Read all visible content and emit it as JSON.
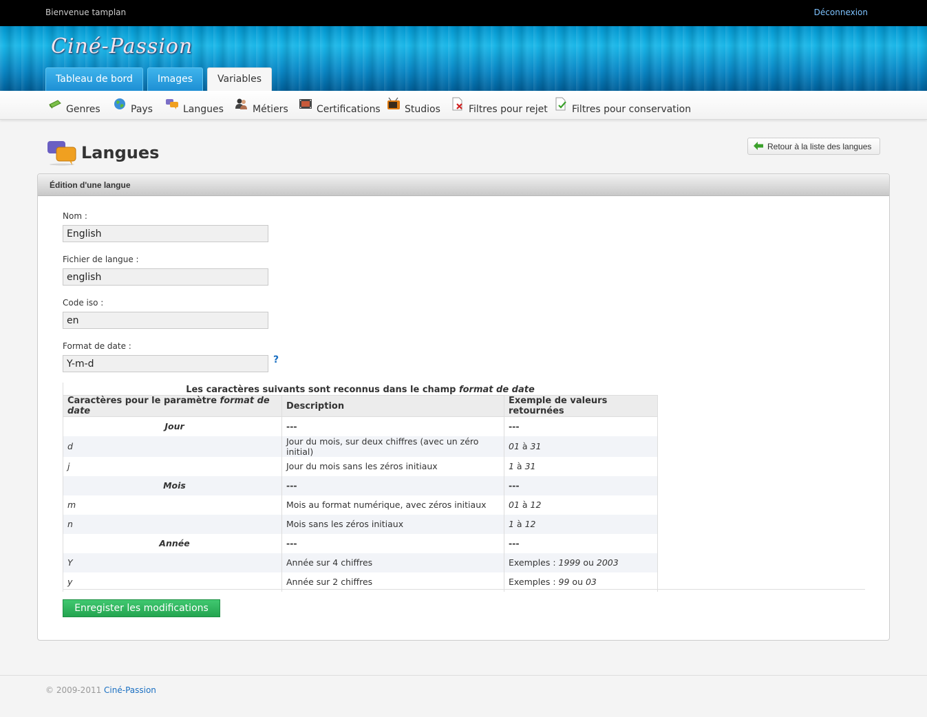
{
  "topbar": {
    "welcome": "Bienvenue tamplan",
    "logout": "Déconnexion"
  },
  "header": {
    "logo": "Ciné-Passion",
    "tabs": [
      {
        "label": "Tableau de bord",
        "active": false
      },
      {
        "label": "Images",
        "active": false
      },
      {
        "label": "Variables",
        "active": true
      }
    ]
  },
  "subnav": {
    "items": [
      {
        "label": "Genres",
        "icon": "genres-icon"
      },
      {
        "label": "Pays",
        "icon": "globe-icon"
      },
      {
        "label": "Langues",
        "icon": "chat-bubbles-icon"
      },
      {
        "label": "Métiers",
        "icon": "users-icon"
      },
      {
        "label": "Certifications",
        "icon": "film-icon"
      },
      {
        "label": "Studios",
        "icon": "tv-icon"
      },
      {
        "label": "Filtres pour rejet",
        "icon": "document-reject-icon"
      },
      {
        "label": "Filtres pour conservation",
        "icon": "document-check-icon"
      }
    ]
  },
  "page": {
    "title": "Langues",
    "back_button": "Retour à la liste des langues",
    "panel_title": "Édition d'une langue"
  },
  "form": {
    "nom_label": "Nom :",
    "nom_value": "English",
    "fichier_label": "Fichier de langue :",
    "fichier_value": "english",
    "code_label": "Code iso :",
    "code_value": "en",
    "format_label": "Format de date :",
    "format_value": "Y-m-d",
    "help": "?"
  },
  "table": {
    "caption_prefix": "Les caractères suivants sont reconnus dans le champ ",
    "caption_em": "format de date",
    "headers": {
      "col1_prefix": "Caractères pour le paramètre ",
      "col1_em": "format de date",
      "col2": "Description",
      "col3": "Exemple de valeurs retournées"
    },
    "dash": "---",
    "sections": {
      "jour": "Jour",
      "mois": "Mois",
      "annee": "Année"
    },
    "rows": {
      "d": {
        "char": "d",
        "desc": "Jour du mois, sur deux chiffres (avec un zéro initial)",
        "ex_a": "01",
        "ex_sep": " à ",
        "ex_b": "31"
      },
      "j": {
        "char": "j",
        "desc": "Jour du mois sans les zéros initiaux",
        "ex_a": "1",
        "ex_sep": " à ",
        "ex_b": "31"
      },
      "m": {
        "char": "m",
        "desc": "Mois au format numérique, avec zéros initiaux",
        "ex_a": "01",
        "ex_sep": " à ",
        "ex_b": "12"
      },
      "n": {
        "char": "n",
        "desc": "Mois sans les zéros initiaux",
        "ex_a": "1",
        "ex_sep": " à ",
        "ex_b": "12"
      },
      "Y": {
        "char": "Y",
        "desc": "Année sur 4 chiffres",
        "ex_pre": "Exemples : ",
        "ex_a": "1999",
        "ex_sep": " ou ",
        "ex_b": "2003"
      },
      "y": {
        "char": "y",
        "desc": "Année sur 2 chiffres",
        "ex_pre": "Exemples : ",
        "ex_a": "99",
        "ex_sep": " ou ",
        "ex_b": "03"
      }
    }
  },
  "save_button": "Enregister les modifications",
  "footer": {
    "copyright": "© 2009-2011 ",
    "link": "Ciné-Passion"
  }
}
